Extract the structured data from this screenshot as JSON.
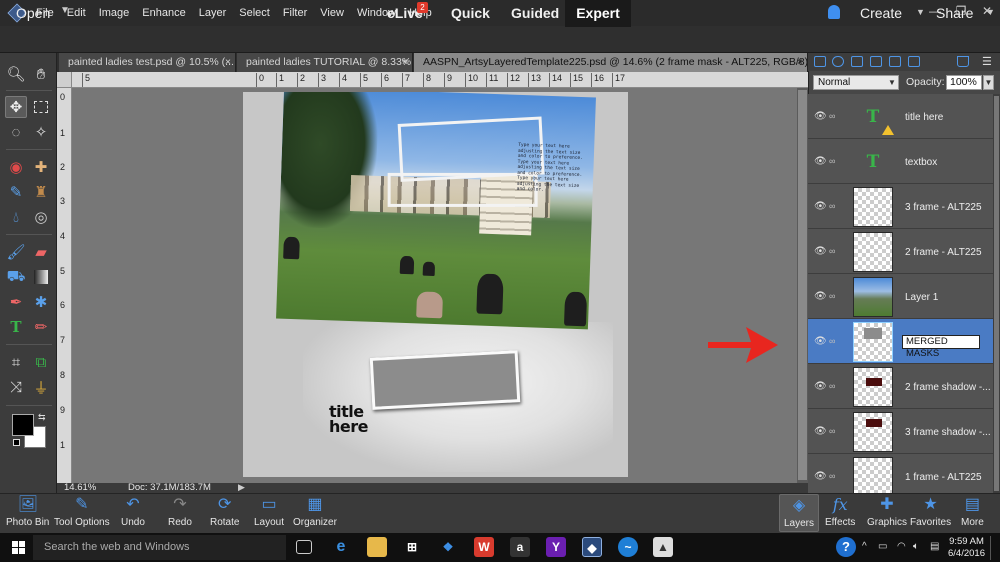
{
  "menu": [
    "File",
    "Edit",
    "Image",
    "Enhance",
    "Layer",
    "Select",
    "Filter",
    "View",
    "Window",
    "Help"
  ],
  "window_controls": [
    "—",
    "❐",
    "✕"
  ],
  "modebar": {
    "open_label": "Open",
    "elive_label": "eLive",
    "elive_badge": "2",
    "quick_label": "Quick",
    "guided_label": "Guided",
    "expert_label": "Expert",
    "create_label": "Create",
    "share_label": "Share"
  },
  "doc_tabs": [
    {
      "label": "painted ladies test.psd @ 10.5% (..."
    },
    {
      "label": "painted ladies TUTORIAL @ 8.33% ..."
    },
    {
      "label": "AASPN_ArtsyLayeredTemplate225.psd @ 14.6% (2 frame mask - ALT225, RGB/8) *"
    }
  ],
  "ruler_h": [
    "5",
    "0",
    "1",
    "2",
    "3",
    "4",
    "5",
    "6",
    "7",
    "8",
    "9",
    "10",
    "11",
    "12",
    "13",
    "14",
    "15",
    "16",
    "17"
  ],
  "ruler_v": [
    "0",
    "1",
    "2",
    "3",
    "4",
    "5",
    "6",
    "7",
    "8",
    "9",
    "1"
  ],
  "canvas": {
    "photo_text": "Type your text here adjusting the text size and color to preference. Type your text here adjusting the text size and color to preference. Type your text here adjusting the text size and color.",
    "doc_title_line1": "title",
    "doc_title_line2": "here"
  },
  "status": {
    "zoom": "14.61%",
    "doc_size": "Doc: 37.1M/183.7M"
  },
  "layers_panel": {
    "blend_mode": "Normal",
    "opacity_label": "Opacity:",
    "opacity_value": "100%",
    "layers": [
      {
        "name": "title here",
        "type": "text",
        "warning": true
      },
      {
        "name": "textbox",
        "type": "text"
      },
      {
        "name": "3 frame - ALT225",
        "type": "transparent"
      },
      {
        "name": "2 frame - ALT225",
        "type": "transparent"
      },
      {
        "name": "Layer 1",
        "type": "photo"
      },
      {
        "name": "MERGED MASKS",
        "type": "mask",
        "selected": true,
        "editing": true
      },
      {
        "name": "2 frame shadow -...",
        "type": "shadow"
      },
      {
        "name": "3 frame shadow -...",
        "type": "shadow"
      },
      {
        "name": "1 frame - ALT225",
        "type": "transparent"
      }
    ]
  },
  "bottom_panel": {
    "photo_bin": "Photo Bin",
    "tool_options": "Tool Options",
    "undo": "Undo",
    "redo": "Redo",
    "rotate": "Rotate",
    "layout": "Layout",
    "organizer": "Organizer",
    "layers": "Layers",
    "effects": "Effects",
    "graphics": "Graphics",
    "favorites": "Favorites",
    "more": "More"
  },
  "taskbar": {
    "search_placeholder": "Search the web and Windows",
    "clock_time": "9:59 AM",
    "clock_date": "6/4/2016"
  },
  "colors": {
    "accent_blue": "#4e95e6",
    "selected_layer": "#4a7bc4",
    "annotation_arrow": "#e8261f",
    "text_layer_icon": "#39b54a"
  }
}
